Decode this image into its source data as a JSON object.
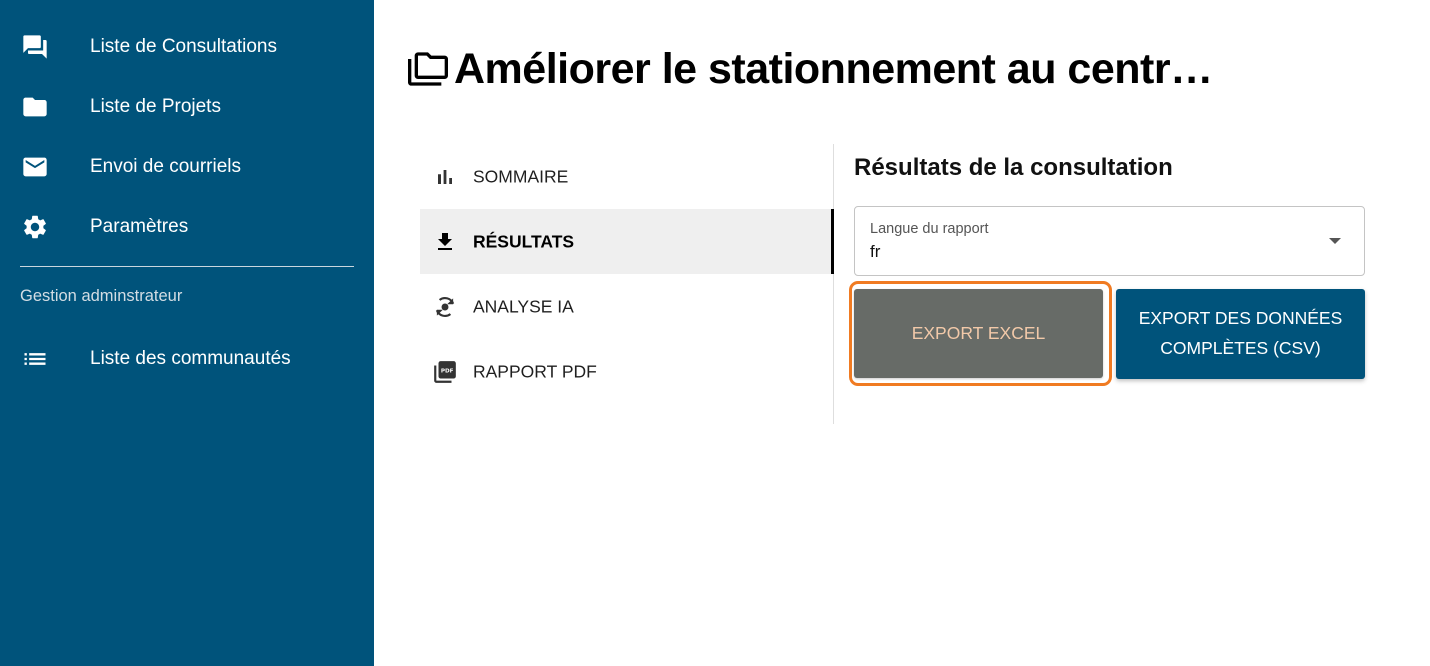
{
  "sidebar": {
    "items": [
      {
        "label": "Liste de Consultations",
        "icon": "chat-bubbles-icon"
      },
      {
        "label": "Liste de Projets",
        "icon": "folder-icon"
      },
      {
        "label": "Envoi de courriels",
        "icon": "mail-icon"
      },
      {
        "label": "Paramètres",
        "icon": "gear-icon"
      }
    ],
    "section_title": "Gestion adminstrateur",
    "admin_items": [
      {
        "label": "Liste des communautés",
        "icon": "list-icon"
      }
    ]
  },
  "page": {
    "title": "Améliorer le stationnement au centr…",
    "title_icon": "folders-icon"
  },
  "tabs": [
    {
      "label": "SOMMAIRE",
      "icon": "bar-chart-icon",
      "active": false
    },
    {
      "label": "RÉSULTATS",
      "icon": "download-icon",
      "active": true
    },
    {
      "label": "ANALYSE IA",
      "icon": "ai-analysis-icon",
      "active": false
    },
    {
      "label": "RAPPORT PDF",
      "icon": "pdf-icon",
      "active": false
    }
  ],
  "panel": {
    "heading": "Résultats de la consultation",
    "language_select": {
      "label": "Langue du rapport",
      "value": "fr"
    },
    "export_excel_label": "EXPORT EXCEL",
    "export_csv_label": "EXPORT DES DONNÉES COMPLÈTES (CSV)"
  },
  "colors": {
    "sidebar_bg": "#00537b",
    "primary_button": "#00537b",
    "excel_button": "#676b67",
    "focus_outline": "#f07b22"
  }
}
